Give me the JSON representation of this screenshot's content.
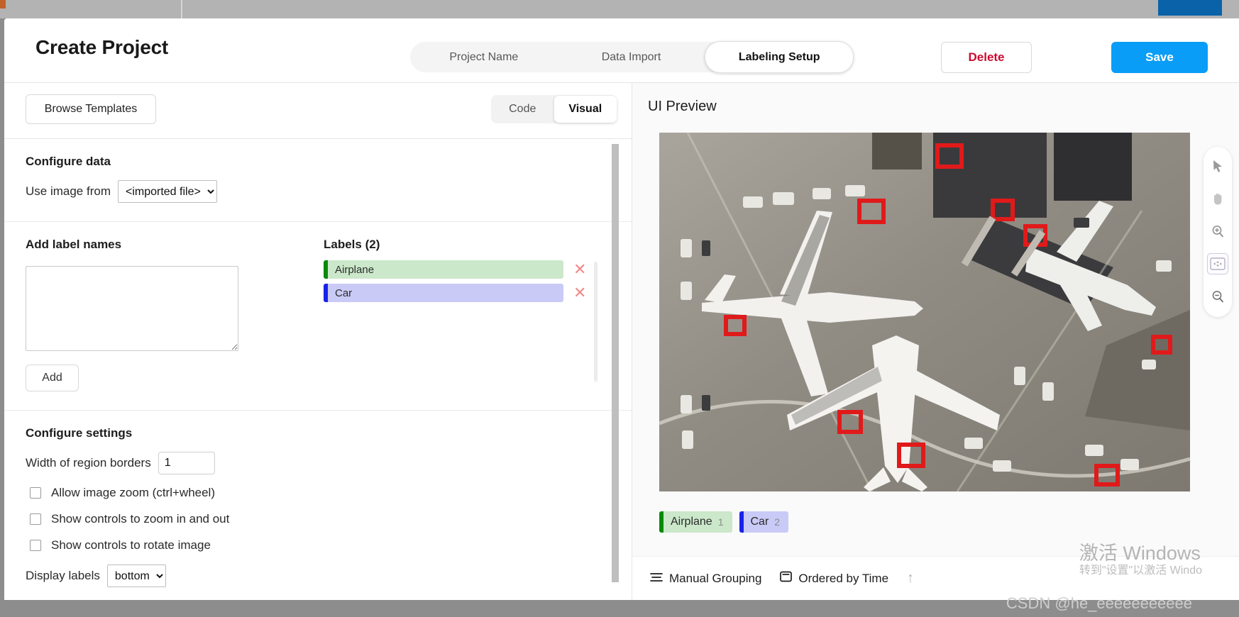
{
  "window": {
    "title": "Create Project"
  },
  "header": {
    "title": "Create Project",
    "tabs": [
      {
        "label": "Project Name",
        "active": false
      },
      {
        "label": "Data Import",
        "active": false
      },
      {
        "label": "Labeling Setup",
        "active": true
      }
    ],
    "delete_label": "Delete",
    "save_label": "Save",
    "delete_color": "#cc0b2e",
    "save_color": "#0a9df7"
  },
  "left_pane": {
    "browse_templates_label": "Browse Templates",
    "view_toggle": {
      "options": [
        "Code",
        "Visual"
      ],
      "selected": "Visual"
    },
    "configure_data": {
      "title": "Configure data",
      "use_image_from_label": "Use image from",
      "use_image_from_value": "<imported file>",
      "use_image_from_options": [
        "<imported file>"
      ]
    },
    "add_label_names": {
      "title": "Add label names",
      "textarea_value": "",
      "textarea_placeholder": "",
      "add_button_label": "Add"
    },
    "labels": {
      "heading": "Labels (2)",
      "items": [
        {
          "name": "Airplane",
          "bar_color": "#0a8a0a",
          "bg_color": "#cbe8ca",
          "delete_icon": "close-icon"
        },
        {
          "name": "Car",
          "bar_color": "#1822e8",
          "bg_color": "#c9caf6",
          "delete_icon": "close-icon"
        }
      ]
    },
    "configure_settings": {
      "title": "Configure settings",
      "width_label": "Width of region borders",
      "width_value": "1",
      "checkboxes": [
        {
          "label": "Allow image zoom (ctrl+wheel)",
          "checked": false
        },
        {
          "label": "Show controls to zoom in and out",
          "checked": false
        },
        {
          "label": "Show controls to rotate image",
          "checked": false
        }
      ],
      "cut_off_row": {
        "label": "Display labels",
        "value": "bottom"
      }
    }
  },
  "right_pane": {
    "preview_title": "UI Preview",
    "image_alt": "aerial-airport-photo",
    "label_chips": [
      {
        "name": "Airplane",
        "hotkey": "1",
        "bar_color": "#0a8a0a",
        "bg_color": "#cbe8ca"
      },
      {
        "name": "Car",
        "hotkey": "2",
        "bar_color": "#1822e8",
        "bg_color": "#c9caf6"
      }
    ],
    "bottom_bar": {
      "grouping_label": "Manual Grouping",
      "grouping_icon": "list-lines-icon",
      "order_label": "Ordered by Time",
      "order_icon": "rectangle-icon",
      "sort_icon": "arrow-up-icon"
    },
    "tools": [
      {
        "name": "cursor-icon",
        "selected": false
      },
      {
        "name": "hand-icon",
        "selected": false
      },
      {
        "name": "zoom-in-icon",
        "selected": false
      },
      {
        "name": "fit-to-screen-icon",
        "selected": true
      },
      {
        "name": "zoom-out-icon",
        "selected": false
      }
    ]
  },
  "watermarks": {
    "windows_line1": "激活 Windows",
    "windows_line2": "转到\"设置\"以激活 Windo",
    "csdn": "CSDN @he_eeeeeeeeeee"
  }
}
